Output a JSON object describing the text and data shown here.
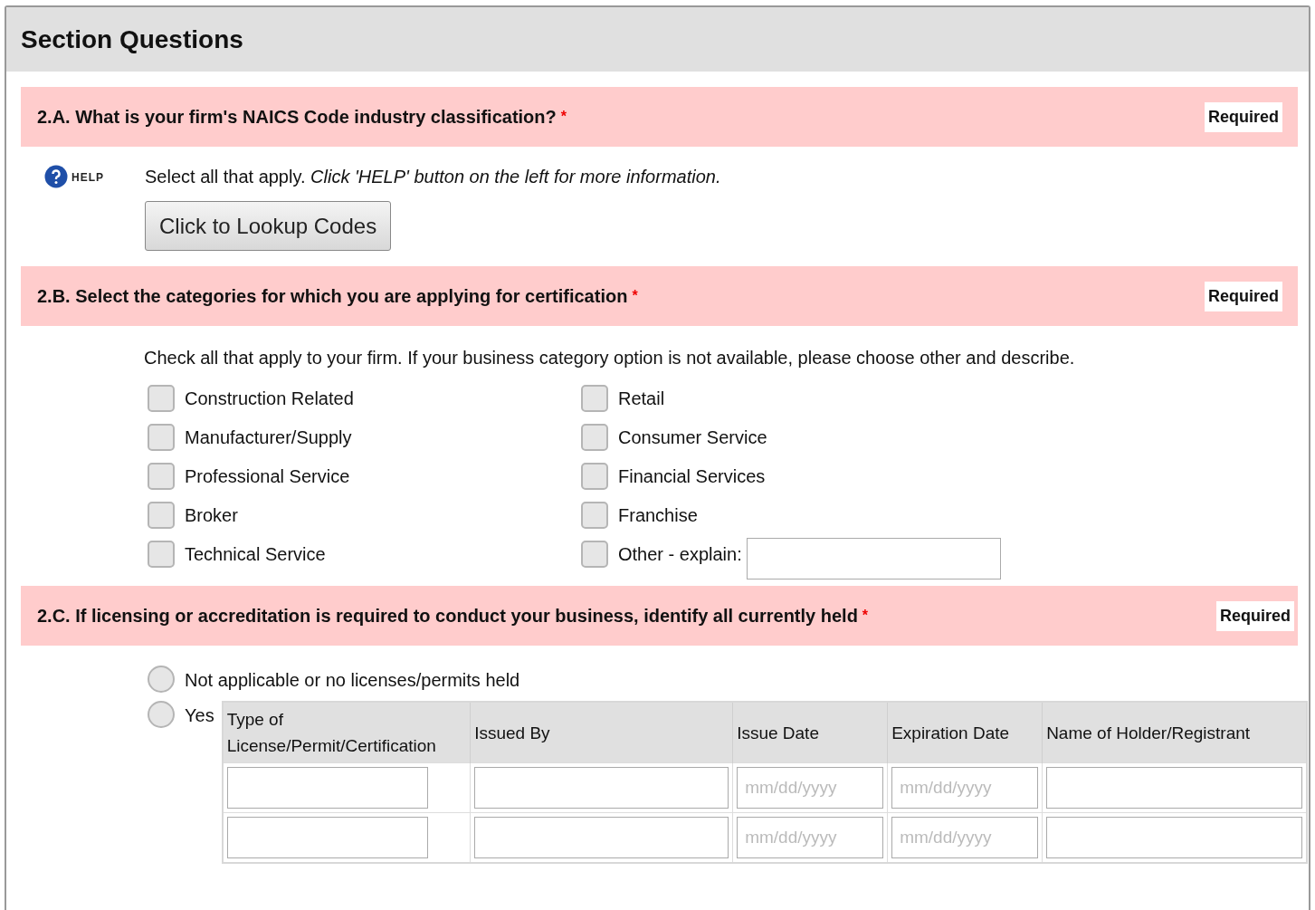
{
  "panel": {
    "title": "Section Questions"
  },
  "questions": [
    {
      "kind": "naics",
      "title": "2.A. What is your firm's NAICS Code industry classification?",
      "required_mark": "*",
      "badge": "Required",
      "help": {
        "label": "HELP"
      },
      "instruction": "Select all that apply. *Click 'HELP' button on the left for more information.*",
      "button": "Click to Lookup Codes"
    },
    {
      "kind": "checkboxes",
      "title": "2.B. Select the categories for which you are applying for certification",
      "required_mark": "*",
      "badge": "Required",
      "instruction": "Check all that apply to your firm. If your business category option is not available, please choose other and describe.",
      "columns": [
        [
          {
            "label": "Construction Related",
            "checked": false
          },
          {
            "label": "Manufacturer/Supply",
            "checked": false
          },
          {
            "label": "Professional Service",
            "checked": false
          },
          {
            "label": "Broker",
            "checked": false
          },
          {
            "label": "Technical Service",
            "checked": false
          }
        ],
        [
          {
            "label": "Retail",
            "checked": false
          },
          {
            "label": "Consumer Service",
            "checked": false
          },
          {
            "label": "Financial Services",
            "checked": false
          },
          {
            "label": "Franchise",
            "checked": false
          },
          {
            "label": "Other - explain:",
            "checked": false,
            "kind": "other"
          }
        ]
      ]
    },
    {
      "kind": "licenses",
      "title": "2.C. If licensing or accreditation is required to conduct your business, identify all currently held",
      "required_mark": "*",
      "badge": "Required",
      "options": [
        {
          "label": "Not applicable or no licenses/permits held",
          "selected": false
        },
        {
          "label": "Yes",
          "selected": false,
          "kind": "table"
        }
      ],
      "table": {
        "columns": [
          "Type of License/Permit/Certification",
          "Issued By",
          "Issue Date",
          "Expiration Date",
          "Name of Holder/Registrant"
        ],
        "rows": [
          {
            "cells": [
              {
                "kind": "text"
              },
              {
                "kind": "text"
              },
              {
                "kind": "date",
                "placeholder": "mm/dd/yyyy"
              },
              {
                "kind": "date",
                "placeholder": "mm/dd/yyyy"
              },
              {
                "kind": "text"
              }
            ]
          },
          {
            "cells": [
              {
                "kind": "text"
              },
              {
                "kind": "text"
              },
              {
                "kind": "date",
                "placeholder": "mm/dd/yyyy"
              },
              {
                "kind": "date",
                "placeholder": "mm/dd/yyyy"
              },
              {
                "kind": "text"
              }
            ]
          }
        ]
      }
    }
  ]
}
